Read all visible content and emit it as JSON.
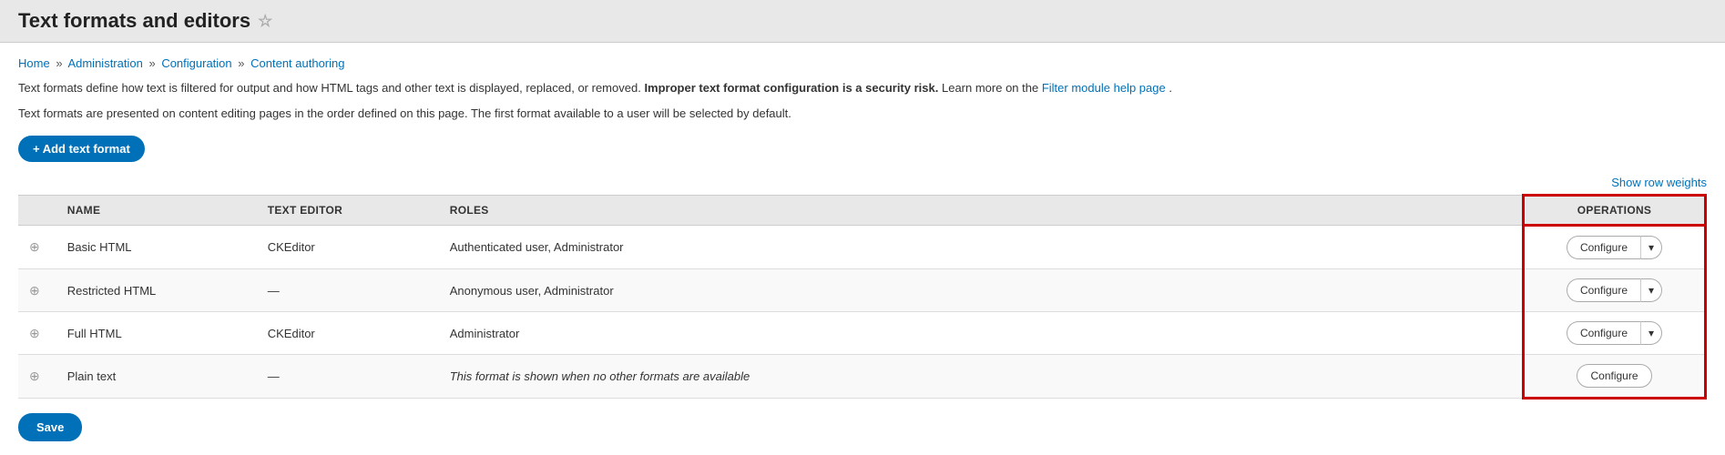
{
  "header": {
    "title": "Text formats and editors",
    "star_icon": "☆"
  },
  "breadcrumb": {
    "items": [
      "Home",
      "Administration",
      "Configuration",
      "Content authoring"
    ],
    "separator": "»"
  },
  "description1_pre": "Text formats define how text is filtered for output and how HTML tags and other text is displayed, replaced, or removed.",
  "description1_bold": "Improper text format configuration is a security risk.",
  "description1_post_pre": " Learn more on the ",
  "description1_link": "Filter module help page",
  "description1_post": ".",
  "description2": "Text formats are presented on content editing pages in the order defined on this page. The first format available to a user will be selected by default.",
  "add_button": "+ Add text format",
  "show_row_weights": "Show row weights",
  "table": {
    "columns": [
      "",
      "NAME",
      "TEXT EDITOR",
      "ROLES",
      "OPERATIONS"
    ],
    "rows": [
      {
        "name": "Basic HTML",
        "editor": "CKEditor",
        "roles": "Authenticated user, Administrator",
        "has_dropdown": true
      },
      {
        "name": "Restricted HTML",
        "editor": "—",
        "roles": "Anonymous user, Administrator",
        "has_dropdown": true
      },
      {
        "name": "Full HTML",
        "editor": "CKEditor",
        "roles": "Administrator",
        "has_dropdown": true
      },
      {
        "name": "Plain text",
        "editor": "—",
        "roles": "This format is shown when no other formats are available",
        "roles_italic": true,
        "has_dropdown": false
      }
    ],
    "configure_label": "Configure",
    "dropdown_arrow": "▾"
  },
  "save_button": "Save"
}
